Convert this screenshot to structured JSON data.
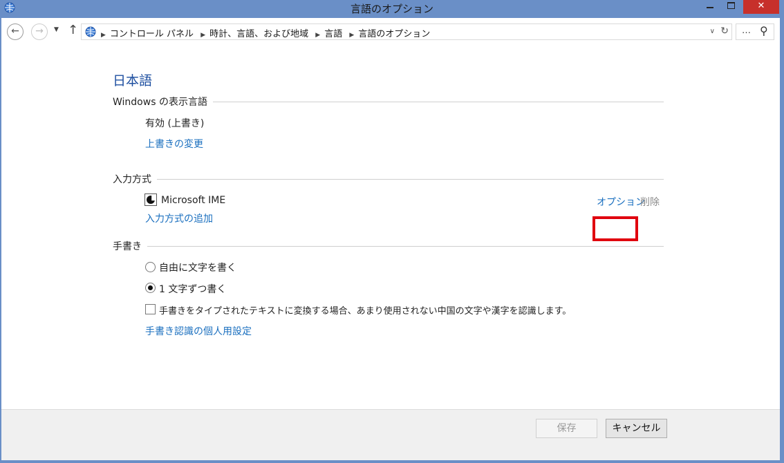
{
  "window": {
    "title": "言語のオプション",
    "close_glyph": "✕"
  },
  "nav": {
    "back_glyph": "←",
    "forward_glyph": "→",
    "up_glyph": "↑",
    "breadcrumbs": [
      "コントロール パネル",
      "時計、言語、および地域",
      "言語",
      "言語のオプション"
    ],
    "search_dots": "…"
  },
  "language": {
    "name": "日本語"
  },
  "display_language": {
    "heading": "Windows の表示言語",
    "status": "有効 (上書き)",
    "change_link": "上書きの変更"
  },
  "input_method": {
    "heading": "入力方式",
    "ime_name": "Microsoft IME",
    "options_link": "オプション",
    "remove_link": "削除",
    "add_link": "入力方式の追加"
  },
  "handwriting": {
    "heading": "手書き",
    "option_free": "自由に文字を書く",
    "option_single": "1 文字ずつ書く",
    "selected": "option_single",
    "checkbox_label": "手書きをタイプされたテキストに変換する場合、あまり使用されない中国の文字や漢字を認識します。",
    "checkbox_checked": false,
    "personalize_link": "手書き認識の個人用設定"
  },
  "footer": {
    "save_label": "保存",
    "cancel_label": "キャンセル"
  },
  "colors": {
    "titlebar": "#6a8fc7",
    "link": "#1a6fbf",
    "heading": "#1e4fa0",
    "highlight": "#e0000e",
    "close_button": "#c7302b"
  }
}
